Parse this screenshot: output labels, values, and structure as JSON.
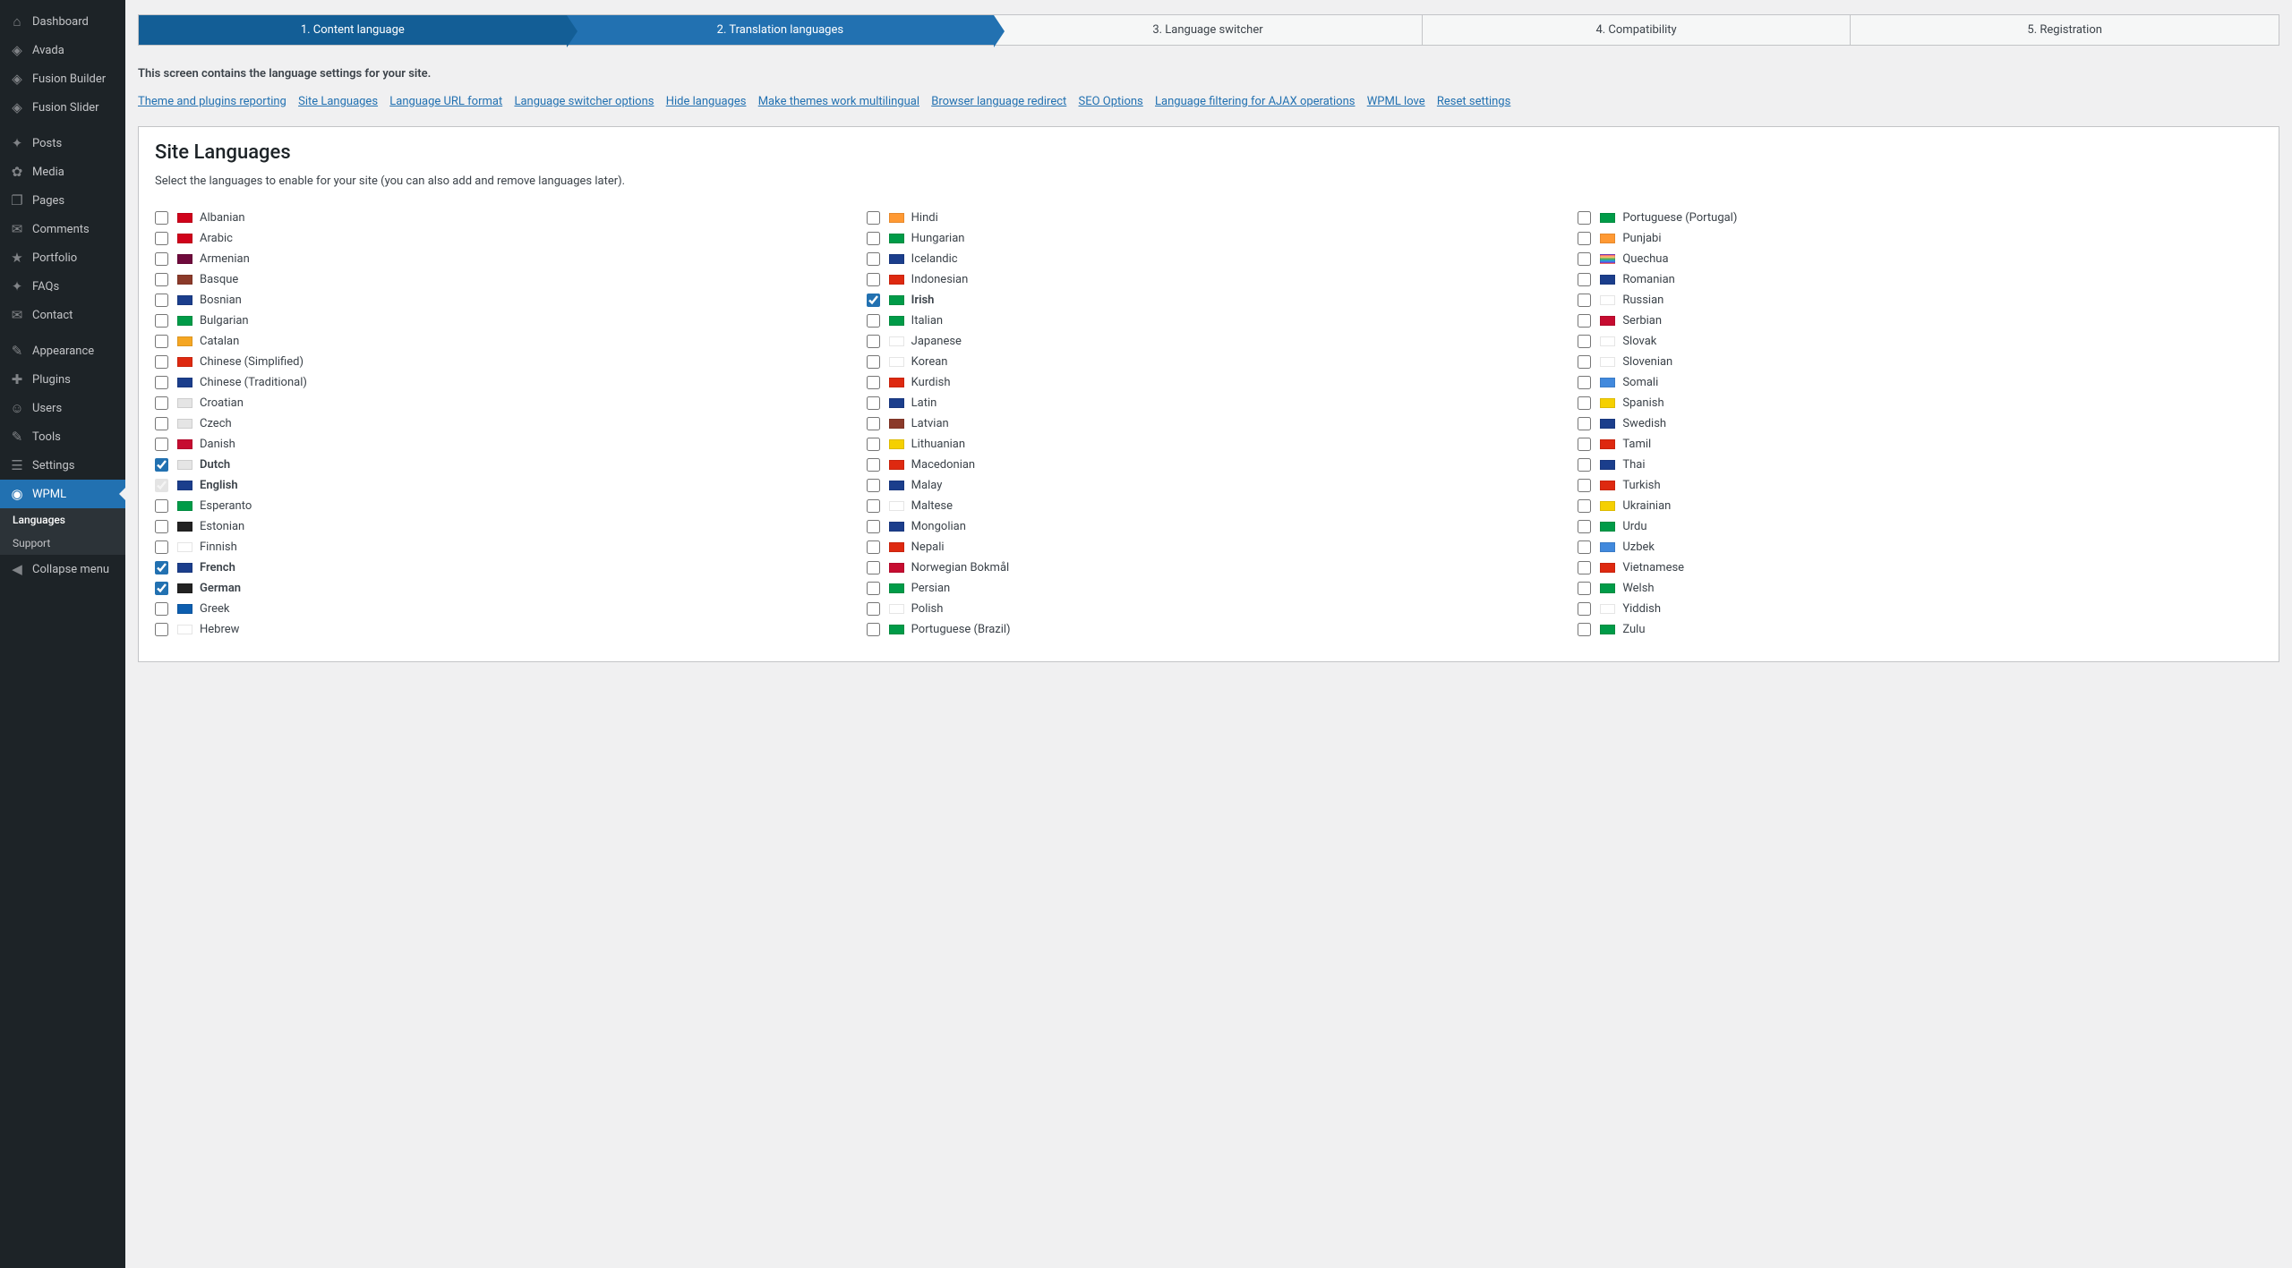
{
  "sidebar": {
    "items": [
      {
        "icon": "dashboard-icon",
        "glyph": "⌂",
        "label": "Dashboard"
      },
      {
        "icon": "avada-icon",
        "glyph": "◈",
        "label": "Avada"
      },
      {
        "icon": "fusion-builder-icon",
        "glyph": "◈",
        "label": "Fusion Builder"
      },
      {
        "icon": "fusion-slider-icon",
        "glyph": "◈",
        "label": "Fusion Slider"
      },
      {
        "sep": true
      },
      {
        "icon": "pin-icon",
        "glyph": "✦",
        "label": "Posts"
      },
      {
        "icon": "media-icon",
        "glyph": "✿",
        "label": "Media"
      },
      {
        "icon": "pages-icon",
        "glyph": "❐",
        "label": "Pages"
      },
      {
        "icon": "comments-icon",
        "glyph": "✉",
        "label": "Comments"
      },
      {
        "icon": "portfolio-icon",
        "glyph": "★",
        "label": "Portfolio"
      },
      {
        "icon": "faqs-icon",
        "glyph": "✦",
        "label": "FAQs"
      },
      {
        "icon": "contact-icon",
        "glyph": "✉",
        "label": "Contact"
      },
      {
        "sep": true
      },
      {
        "icon": "appearance-icon",
        "glyph": "✎",
        "label": "Appearance"
      },
      {
        "icon": "plugins-icon",
        "glyph": "✚",
        "label": "Plugins"
      },
      {
        "icon": "users-icon",
        "glyph": "☺",
        "label": "Users"
      },
      {
        "icon": "tools-icon",
        "glyph": "✎",
        "label": "Tools"
      },
      {
        "icon": "settings-icon",
        "glyph": "☰",
        "label": "Settings"
      },
      {
        "icon": "wpml-icon",
        "glyph": "◉",
        "label": "WPML",
        "active": true
      },
      {
        "sub": true,
        "label": "Languages",
        "emph": true
      },
      {
        "sub": true,
        "label": "Support"
      },
      {
        "icon": "collapse-icon",
        "glyph": "◀",
        "label": "Collapse menu"
      }
    ]
  },
  "wizard": {
    "steps": [
      {
        "label": "1. Content language",
        "state": "done"
      },
      {
        "label": "2. Translation languages",
        "state": "active"
      },
      {
        "label": "3. Language switcher",
        "state": ""
      },
      {
        "label": "4. Compatibility",
        "state": ""
      },
      {
        "label": "5. Registration",
        "state": ""
      }
    ]
  },
  "intro": {
    "title": "This screen contains the language settings for your site.",
    "links": [
      "Theme and plugins reporting",
      "Site Languages",
      "Language URL format",
      "Language switcher options",
      "Hide languages",
      "Make themes work multilingual",
      "Browser language redirect",
      "SEO Options",
      "Language filtering for AJAX operations",
      "WPML love",
      "Reset settings"
    ]
  },
  "panel": {
    "heading": "Site Languages",
    "sub": "Select the languages to enable for your site (you can also add and remove languages later)."
  },
  "languages": [
    {
      "name": "Albanian",
      "flag": "#D0021B",
      "checked": false
    },
    {
      "name": "Arabic",
      "flag": "#D0021B",
      "checked": false
    },
    {
      "name": "Armenian",
      "flag": "#6f0a3c",
      "checked": false
    },
    {
      "name": "Basque",
      "flag": "#8b3a2a",
      "checked": false
    },
    {
      "name": "Bosnian",
      "flag": "#1b3e8c",
      "checked": false
    },
    {
      "name": "Bulgarian",
      "flag": "#009b48",
      "checked": false
    },
    {
      "name": "Catalan",
      "flag": "#f5a623",
      "checked": false
    },
    {
      "name": "Chinese (Simplified)",
      "flag": "#de2910",
      "checked": false
    },
    {
      "name": "Chinese (Traditional)",
      "flag": "#1b3e8c",
      "checked": false
    },
    {
      "name": "Croatian",
      "flag": "#e5e5e5",
      "checked": false
    },
    {
      "name": "Czech",
      "flag": "#e5e5e5",
      "checked": false
    },
    {
      "name": "Danish",
      "flag": "#c60c30",
      "checked": false
    },
    {
      "name": "Dutch",
      "flag": "#e5e5e5",
      "checked": true
    },
    {
      "name": "English",
      "flag": "#1b3e8c",
      "checked": true,
      "disabled": true,
      "defaultLang": true
    },
    {
      "name": "Esperanto",
      "flag": "#009b48",
      "checked": false
    },
    {
      "name": "Estonian",
      "flag": "#222",
      "checked": false
    },
    {
      "name": "Finnish",
      "flag": "#ffffff",
      "checked": false
    },
    {
      "name": "French",
      "flag": "#1b3e8c",
      "checked": true
    },
    {
      "name": "German",
      "flag": "#222",
      "checked": true
    },
    {
      "name": "Greek",
      "flag": "#0d5eaf",
      "checked": false
    },
    {
      "name": "Hebrew",
      "flag": "#ffffff",
      "checked": false
    },
    {
      "name": "Hindi",
      "flag": "#ff9933",
      "checked": false
    },
    {
      "name": "Hungarian",
      "flag": "#009b48",
      "checked": false
    },
    {
      "name": "Icelandic",
      "flag": "#1b3e8c",
      "checked": false
    },
    {
      "name": "Indonesian",
      "flag": "#de2910",
      "checked": false
    },
    {
      "name": "Irish",
      "flag": "#009b48",
      "checked": true
    },
    {
      "name": "Italian",
      "flag": "#009b48",
      "checked": false
    },
    {
      "name": "Japanese",
      "flag": "#ffffff",
      "checked": false
    },
    {
      "name": "Korean",
      "flag": "#ffffff",
      "checked": false
    },
    {
      "name": "Kurdish",
      "flag": "#de2910",
      "checked": false
    },
    {
      "name": "Latin",
      "flag": "#1b3e8c",
      "checked": false
    },
    {
      "name": "Latvian",
      "flag": "#8b3a2a",
      "checked": false
    },
    {
      "name": "Lithuanian",
      "flag": "#f5d000",
      "checked": false
    },
    {
      "name": "Macedonian",
      "flag": "#de2910",
      "checked": false
    },
    {
      "name": "Malay",
      "flag": "#1b3e8c",
      "checked": false
    },
    {
      "name": "Maltese",
      "flag": "#ffffff",
      "checked": false
    },
    {
      "name": "Mongolian",
      "flag": "#1b3e8c",
      "checked": false
    },
    {
      "name": "Nepali",
      "flag": "#de2910",
      "checked": false
    },
    {
      "name": "Norwegian Bokmål",
      "flag": "#c60c30",
      "checked": false
    },
    {
      "name": "Persian",
      "flag": "#009b48",
      "checked": false
    },
    {
      "name": "Polish",
      "flag": "#ffffff",
      "checked": false
    },
    {
      "name": "Portuguese (Brazil)",
      "flag": "#009b48",
      "checked": false
    },
    {
      "name": "Portuguese (Portugal)",
      "flag": "#009b48",
      "checked": false
    },
    {
      "name": "Punjabi",
      "flag": "#ff9933",
      "checked": false
    },
    {
      "name": "Quechua",
      "flag": "linear-gradient(180deg,#ff5f6d,#ffc371,#4caf50,#2196f3,#9c27b0)",
      "checked": false
    },
    {
      "name": "Romanian",
      "flag": "#1b3e8c",
      "checked": false
    },
    {
      "name": "Russian",
      "flag": "#ffffff",
      "checked": false
    },
    {
      "name": "Serbian",
      "flag": "#c60c30",
      "checked": false
    },
    {
      "name": "Slovak",
      "flag": "#ffffff",
      "checked": false
    },
    {
      "name": "Slovenian",
      "flag": "#ffffff",
      "checked": false
    },
    {
      "name": "Somali",
      "flag": "#4189dd",
      "checked": false
    },
    {
      "name": "Spanish",
      "flag": "#f5d000",
      "checked": false
    },
    {
      "name": "Swedish",
      "flag": "#1b3e8c",
      "checked": false
    },
    {
      "name": "Tamil",
      "flag": "#de2910",
      "checked": false
    },
    {
      "name": "Thai",
      "flag": "#1b3e8c",
      "checked": false
    },
    {
      "name": "Turkish",
      "flag": "#de2910",
      "checked": false
    },
    {
      "name": "Ukrainian",
      "flag": "#f5d000",
      "checked": false
    },
    {
      "name": "Urdu",
      "flag": "#009b48",
      "checked": false
    },
    {
      "name": "Uzbek",
      "flag": "#4189dd",
      "checked": false
    },
    {
      "name": "Vietnamese",
      "flag": "#de2910",
      "checked": false
    },
    {
      "name": "Welsh",
      "flag": "#009b48",
      "checked": false
    },
    {
      "name": "Yiddish",
      "flag": "#ffffff",
      "checked": false
    },
    {
      "name": "Zulu",
      "flag": "#009b48",
      "checked": false
    }
  ]
}
